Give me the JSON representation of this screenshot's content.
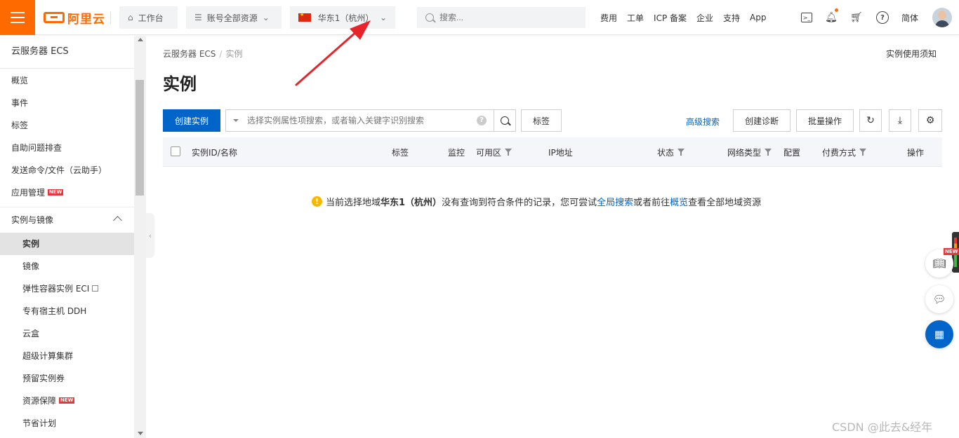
{
  "topbar": {
    "logo_text": "阿里云",
    "workbench_label": "工作台",
    "resources_label": "账号全部资源",
    "region_label": "华东1（杭州）",
    "search_placeholder": "搜索...",
    "nav_links": [
      "费用",
      "工单",
      "ICP 备案",
      "企业",
      "支持",
      "App"
    ],
    "lang_label": "简体"
  },
  "sidebar": {
    "title": "云服务器 ECS",
    "items": [
      "概览",
      "事件",
      "标签",
      "自助问题排查",
      "发送命令/文件（云助手）",
      "应用管理"
    ],
    "group_label": "实例与镜像",
    "sub_items": [
      "实例",
      "镜像",
      "弹性容器实例 ECI",
      "专有宿主机 DDH",
      "云盒",
      "超级计算集群",
      "预留实例券",
      "资源保障",
      "节省计划"
    ],
    "new_badge": "NEW"
  },
  "main": {
    "breadcrumb": [
      "云服务器 ECS",
      "实例"
    ],
    "notice_link": "实例使用须知",
    "title": "实例",
    "create_button": "创建实例",
    "filter_placeholder": "选择实例属性项搜索，或者输入关键字识别搜索",
    "tag_button": "标签",
    "advanced_search": "高级搜索",
    "diagnose_button": "创建诊断",
    "batch_button": "批量操作",
    "columns": [
      "实例ID/名称",
      "标签",
      "监控",
      "可用区",
      "IP地址",
      "状态",
      "网络类型",
      "配置",
      "付费方式",
      "操作"
    ],
    "empty": {
      "prefix": "当前选择地域",
      "region": "华东1（杭州）",
      "middle": "没有查询到符合条件的记录，您可尝试",
      "link1": "全局搜索",
      "middle2": "或者前往",
      "link2": "概览",
      "suffix": "查看全部地域资源"
    }
  },
  "floating": {
    "new_badge": "NEW"
  },
  "watermark": "CSDN @此去&经年",
  "colors": {
    "brand": "#ff6a00",
    "primary": "#0064c8",
    "annotation": "#e8242b"
  }
}
